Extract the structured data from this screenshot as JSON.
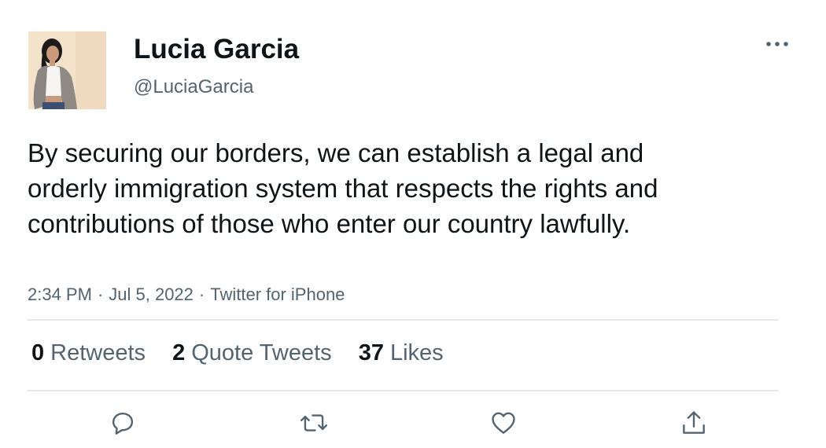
{
  "user": {
    "display_name": "Lucia Garcia",
    "handle": "@LuciaGarcia"
  },
  "tweet": {
    "text": "By securing our borders, we can establish a legal and orderly immigration system that respects the rights and contributions of those who enter our country lawfully.",
    "time": "2:34 PM",
    "separator": "·",
    "date": "Jul 5, 2022",
    "source": "Twitter for iPhone"
  },
  "stats": {
    "retweets": {
      "count": "0",
      "label": "Retweets"
    },
    "quotes": {
      "count": "2",
      "label": "Quote Tweets"
    },
    "likes": {
      "count": "37",
      "label": "Likes"
    }
  },
  "icons": {
    "more": "more-horizontal-icon",
    "reply": "reply-icon",
    "retweet": "retweet-icon",
    "like": "heart-icon",
    "share": "share-icon"
  },
  "colors": {
    "text": "#0f1419",
    "secondary": "#536471",
    "divider": "#e5e7eb"
  }
}
